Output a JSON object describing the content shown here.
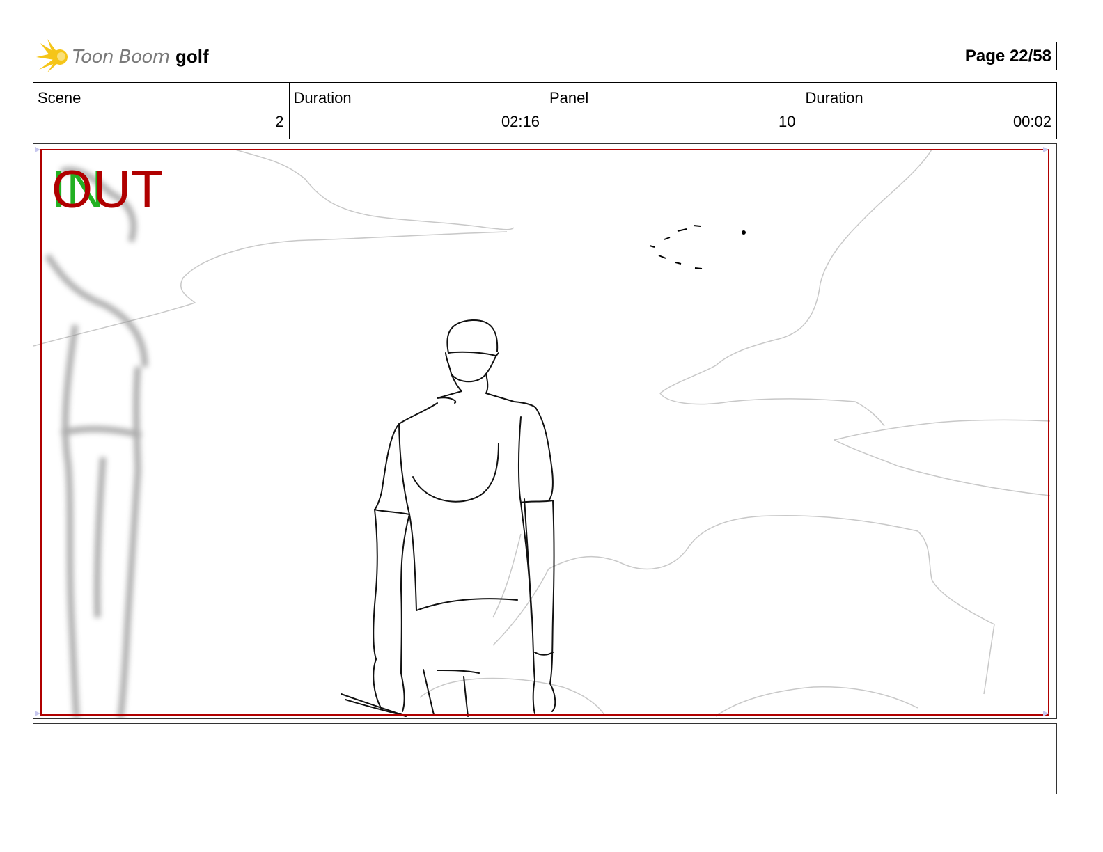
{
  "header": {
    "logo_text": "Toon Boom",
    "project_title": "golf",
    "page_label": "Page 22/58"
  },
  "info": {
    "scene_label": "Scene",
    "scene_value": "2",
    "scene_duration_label": "Duration",
    "scene_duration_value": "02:16",
    "panel_label": "Panel",
    "panel_value": "10",
    "panel_duration_label": "Duration",
    "panel_duration_value": "00:02"
  },
  "panel": {
    "in_marker": "IN",
    "out_marker": "OUT",
    "safe_frame_color": "#b00000"
  },
  "notes": {
    "text": ""
  },
  "colors": {
    "in_marker": "#22b022",
    "out_marker": "#b00000",
    "logo_burst": "#f5c518"
  }
}
